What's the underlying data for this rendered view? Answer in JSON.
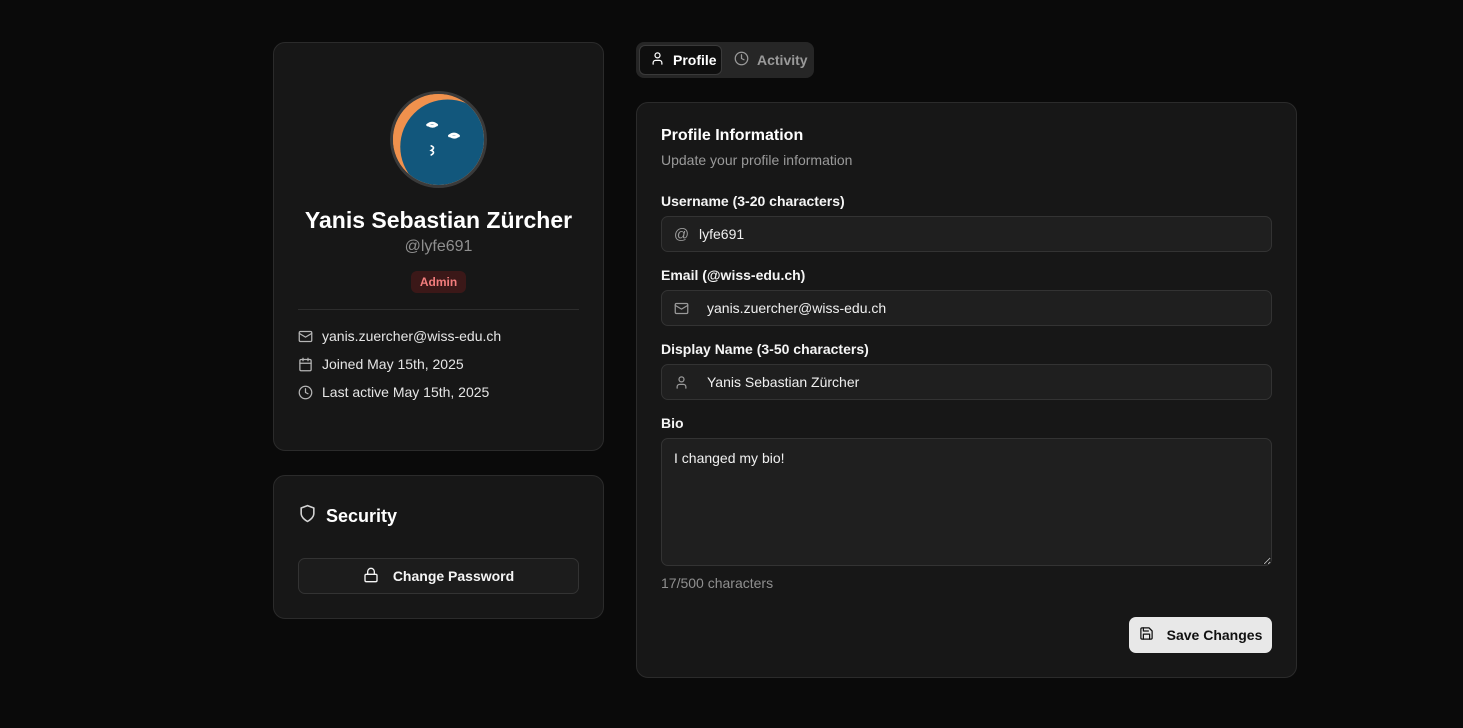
{
  "profile": {
    "display_name": "Yanis Sebastian Zürcher",
    "handle": "@lyfe691",
    "role": "Admin",
    "email": "yanis.zuercher@wiss-edu.ch",
    "joined": "Joined May 15th, 2025",
    "last_active": "Last active May 15th, 2025"
  },
  "security": {
    "title": "Security",
    "change_password_label": "Change Password"
  },
  "tabs": [
    {
      "label": "Profile",
      "icon": "user-icon",
      "active": true
    },
    {
      "label": "Activity",
      "icon": "clock-icon",
      "active": false
    }
  ],
  "form": {
    "title": "Profile Information",
    "subtitle": "Update your profile information",
    "username_label": "Username (3-20 characters)",
    "username_value": "lyfe691",
    "email_label": "Email (@wiss-edu.ch)",
    "email_value": "yanis.zuercher@wiss-edu.ch",
    "display_name_label": "Display Name (3-50 characters)",
    "display_name_value": "Yanis Sebastian Zürcher",
    "bio_label": "Bio",
    "bio_value": "I changed my bio!",
    "char_count": "17/500 characters",
    "save_label": "Save Changes"
  },
  "colors": {
    "background": "#0a0a0a",
    "card": "#171717",
    "admin_badge_bg": "#3b1818",
    "admin_badge_text": "#f37d7d",
    "avatar_orange": "#f0914d",
    "avatar_blue": "#12577c"
  }
}
